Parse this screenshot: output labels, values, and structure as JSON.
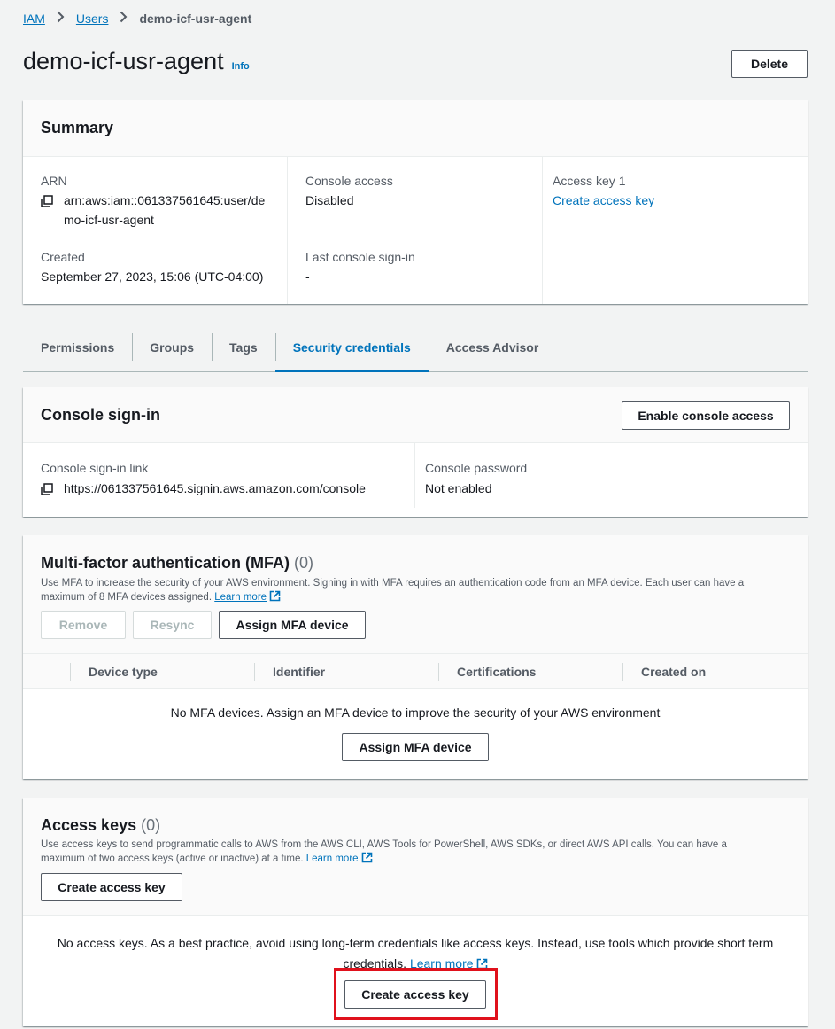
{
  "breadcrumb": {
    "iam": "IAM",
    "users": "Users",
    "current": "demo-icf-usr-agent"
  },
  "page": {
    "title": "demo-icf-usr-agent",
    "info": "Info",
    "delete_label": "Delete"
  },
  "summary": {
    "title": "Summary",
    "arn_label": "ARN",
    "arn_line1": "arn:aws:iam::061337561645:user/de",
    "arn_line2": "mo-icf-usr-agent",
    "created_label": "Created",
    "created_value": "September 27, 2023, 15:06 (UTC-04:00)",
    "console_access_label": "Console access",
    "console_access_value": "Disabled",
    "last_signin_label": "Last console sign-in",
    "last_signin_value": "-",
    "access_key_label": "Access key 1",
    "access_key_link": "Create access key"
  },
  "tabs": [
    {
      "label": "Permissions"
    },
    {
      "label": "Groups"
    },
    {
      "label": "Tags"
    },
    {
      "label": "Security credentials"
    },
    {
      "label": "Access Advisor"
    }
  ],
  "console_signin": {
    "title": "Console sign-in",
    "enable_label": "Enable console access",
    "link_label": "Console sign-in link",
    "link_value": "https://061337561645.signin.aws.amazon.com/console",
    "password_label": "Console password",
    "password_value": "Not enabled"
  },
  "mfa": {
    "title": "Multi-factor authentication (MFA)",
    "count": "(0)",
    "desc_line1": "Use MFA to increase the security of your AWS environment. Signing in with MFA requires an authentication code from an MFA device. Each user can have a",
    "desc_line2": "maximum of 8 MFA devices assigned.",
    "learn_more": "Learn more",
    "remove_label": "Remove",
    "resync_label": "Resync",
    "assign_label": "Assign MFA device",
    "columns": [
      "Device type",
      "Identifier",
      "Certifications",
      "Created on"
    ],
    "empty_msg": "No MFA devices. Assign an MFA device to improve the security of your AWS environment",
    "empty_assign_label": "Assign MFA device"
  },
  "access_keys": {
    "title": "Access keys",
    "count": "(0)",
    "desc_line1": "Use access keys to send programmatic calls to AWS from the AWS CLI, AWS Tools for PowerShell, AWS SDKs, or direct AWS API calls. You can have a",
    "desc_line2": "maximum of two access keys (active or inactive) at a time.",
    "learn_more": "Learn more",
    "create_label": "Create access key",
    "empty_line1": "No access keys. As a best practice, avoid using long-term credentials like access keys. Instead, use tools which provide short term",
    "empty_line2": "credentials.",
    "empty_learn_more": "Learn more",
    "empty_create_label": "Create access key"
  },
  "colors": {
    "link": "#0073bb",
    "highlight": "#e0111c"
  }
}
